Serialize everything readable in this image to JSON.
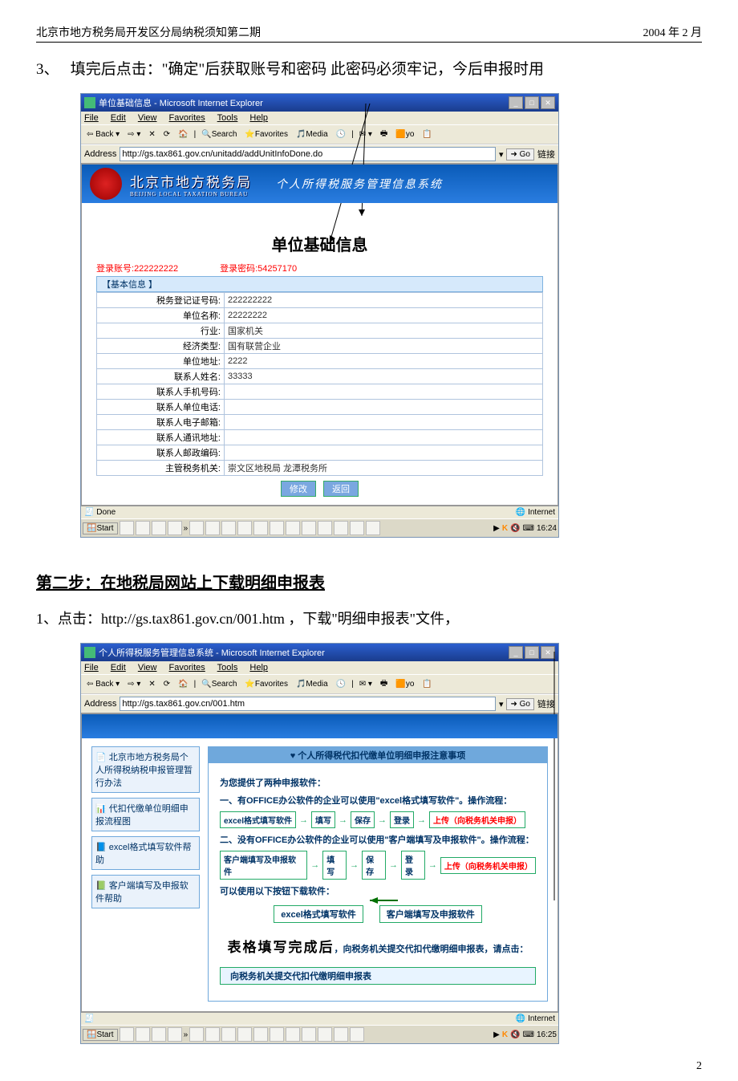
{
  "doc": {
    "header_left": "北京市地方税务局开发区分局纳税须知第二期",
    "header_right": "2004 年 2 月",
    "page_number": "2"
  },
  "instr1": {
    "num": "3、",
    "text": "填完后点击：\"确定\"后获取账号和密码   此密码必须牢记，今后申报时用"
  },
  "step2": {
    "heading": "第二步：在地税局网站上下载明细申报表",
    "item1_num": "1、",
    "item1_text": "点击：http://gs.tax861.gov.cn/001.htm ，下载\"明细申报表\"文件，"
  },
  "ss1": {
    "title": "单位基础信息 - Microsoft Internet Explorer",
    "menus": [
      "File",
      "Edit",
      "View",
      "Favorites",
      "Tools",
      "Help"
    ],
    "back": "Back",
    "search": "Search",
    "fav": "Favorites",
    "media": "Media",
    "addr_label": "Address",
    "url": "http://gs.tax861.gov.cn/unitadd/addUnitInfoDone.do",
    "go": "Go",
    "links": "链接",
    "banner_t1": "北京市地方税务局",
    "banner_sub": "BEIJING LOCAL TAXATION BUREAU",
    "banner_t2": "个人所得税服务管理信息系统",
    "page_title": "单位基础信息",
    "login_label": "登录账号:",
    "login_val": "222222222",
    "pwd_label": "登录密码:",
    "pwd_val": "54257170",
    "section": "【基本信息 】",
    "fields": [
      {
        "label": "税务登记证号码:",
        "value": "222222222"
      },
      {
        "label": "单位名称:",
        "value": "22222222"
      },
      {
        "label": "行业:",
        "value": "国家机关"
      },
      {
        "label": "经济类型:",
        "value": "国有联营企业"
      },
      {
        "label": "单位地址:",
        "value": "2222"
      },
      {
        "label": "联系人姓名:",
        "value": "33333"
      },
      {
        "label": "联系人手机号码:",
        "value": ""
      },
      {
        "label": "联系人单位电话:",
        "value": ""
      },
      {
        "label": "联系人电子邮箱:",
        "value": ""
      },
      {
        "label": "联系人通讯地址:",
        "value": ""
      },
      {
        "label": "联系人邮政编码:",
        "value": ""
      },
      {
        "label": "主管税务机关:",
        "value": "崇文区地税局 龙潭税务所"
      }
    ],
    "btn_modify": "修改",
    "btn_back": "返回",
    "status_done": "Done",
    "status_zone": "Internet",
    "start": "Start",
    "clock": "16:24"
  },
  "ss2": {
    "title": "个人所得税服务管理信息系统 - Microsoft Internet Explorer",
    "addr_label": "Address",
    "url": "http://gs.tax861.gov.cn/001.htm",
    "go": "Go",
    "links": "链接",
    "left_items": [
      "北京市地方税务局个人所得税纳税申报管理暂行办法",
      "代扣代缴单位明细申报流程图",
      "excel格式填写软件帮助",
      "客户端填写及申报软件帮助"
    ],
    "right_title": "个人所得税代扣代缴单位明细申报注意事项",
    "p_intro": "为您提供了两种申报软件：",
    "p_one": "一、有OFFICE办公软件的企业可以使用\"excel格式填写软件\"。操作流程：",
    "flow1": [
      "excel格式填写软件",
      "填写",
      "保存",
      "登录"
    ],
    "flow1_up": "上传（向税务机关申报）",
    "p_two": "二、没有OFFICE办公软件的企业可以使用\"客户端填写及申报软件\"。操作流程：",
    "flow2": [
      "客户端填写及申报软件",
      "填写",
      "保存",
      "登录"
    ],
    "flow2_up": "上传（向税务机关申报）",
    "dl_hint": "可以使用以下按钮下载软件：",
    "dl1": "excel格式填写软件",
    "dl2": "客户端填写及申报软件",
    "big": "表格填写完成后",
    "big_tail": "，向税务机关提交代扣代缴明细申报表，请点击：",
    "submit": "向税务机关提交代扣代缴明细申报表",
    "status_zone": "Internet",
    "start": "Start",
    "clock": "16:25"
  }
}
